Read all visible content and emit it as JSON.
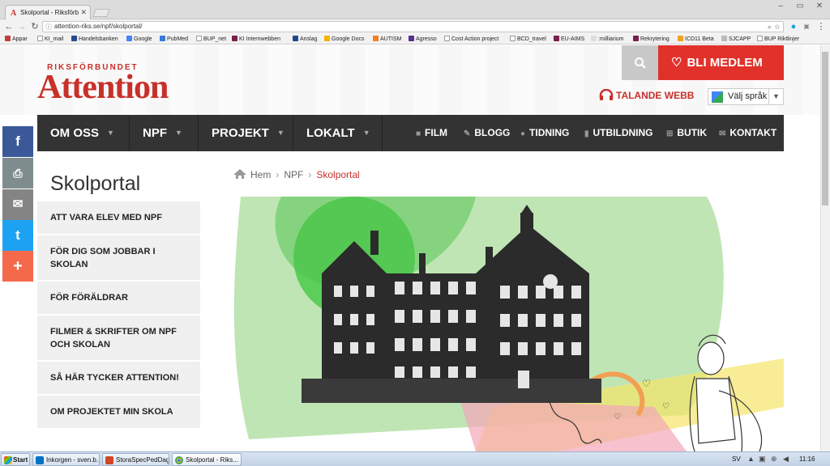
{
  "browser": {
    "tab_title": "Skolportal - Riksförb",
    "url": "attention-riks.se/npf/skolportal/",
    "bookmarks": [
      "Appar",
      "KI_mail",
      "Handelsbanken",
      "Google",
      "PubMed",
      "BUP_net",
      "KI Internwebben",
      "Anslag",
      "Google Docs",
      "AUTISM",
      "Agresso",
      "Cost Action project",
      "BCD_travel",
      "EU-AIMS",
      ":milliarium",
      "Rekrytering",
      "ICD11 Beta",
      "SJCAPP",
      "BUP Riktlinjer"
    ]
  },
  "header": {
    "logo_small": "RIKSFÖRBUNDET",
    "logo_big": "Attention",
    "member_button": "BLI MEDLEM",
    "talande": "TALANDE WEBB",
    "lang": "Välj språk"
  },
  "nav": {
    "main": [
      "OM OSS",
      "NPF",
      "PROJEKT",
      "LOKALT"
    ],
    "secondary": [
      {
        "label": "FILM",
        "icon": "film-icon"
      },
      {
        "label": "BLOGG",
        "icon": "pencil-icon"
      },
      {
        "label": "TIDNING",
        "icon": "info-icon"
      },
      {
        "label": "UTBILDNING",
        "icon": "bookmark-icon"
      },
      {
        "label": "BUTIK",
        "icon": "cart-icon"
      },
      {
        "label": "KONTAKT",
        "icon": "mail-icon"
      }
    ]
  },
  "sidebar": {
    "title": "Skolportal",
    "items": [
      "ATT VARA ELEV MED NPF",
      "FÖR DIG SOM JOBBAR I SKOLAN",
      "FÖR FÖRÄLDRAR",
      "FILMER & SKRIFTER OM NPF OCH SKOLAN",
      "SÅ HÄR TYCKER ATTENTION!",
      "OM PROJEKTET MIN SKOLA"
    ]
  },
  "breadcrumb": {
    "home": "Hem",
    "parent": "NPF",
    "current": "Skolportal"
  },
  "taskbar": {
    "start": "Start",
    "items": [
      "Inkorgen - sven.b...",
      "StoraSpecPedDag...",
      "Skolportal - Riks..."
    ],
    "lang": "SV",
    "time": "11:16"
  },
  "colors": {
    "brand_red": "#c8302a",
    "nav_bg": "#333333",
    "facebook": "#3b5998",
    "twitter": "#1da1f2"
  }
}
